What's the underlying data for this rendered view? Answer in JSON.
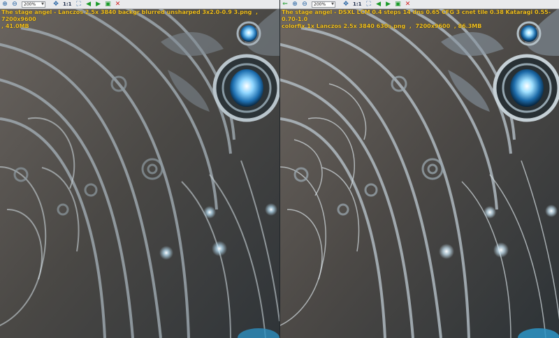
{
  "left_pane": {
    "zoom": "200%",
    "actual_size_label": "1:1",
    "caption": "The stage angel - Lanczos 2.5x 3840 backgr blurred unsharped 3x2.0-0.9 3.png  ,  7200x9600\n, 41.0MB",
    "icons": [
      "zoom-in-icon",
      "zoom-out-icon",
      "nav-icon",
      "fit-window-icon",
      "prev-image-icon",
      "next-image-icon",
      "save-icon",
      "close-icon"
    ]
  },
  "right_pane": {
    "zoom": "200%",
    "actual_size_label": "1:1",
    "caption": "The stage angel - DSXL LCM 0.4 steps 14 dns 0.65 CFG 3 cnet tile 0.38 Kataragi 0.55-0.70-1.0\ncolorfix 1x Lanczos 2.5x 3840 630s.png  ,  7200x9600  , 86.3MB",
    "icons": [
      "sync-arrow-icon",
      "zoom-in-icon",
      "zoom-out-icon",
      "nav-icon",
      "fit-window-icon",
      "prev-image-icon",
      "next-image-icon",
      "save-icon",
      "close-icon"
    ]
  },
  "colors": {
    "caption_text": "#f4c21e",
    "toolbar_bg": "#e9eaec",
    "background": "#4a4c4f"
  }
}
